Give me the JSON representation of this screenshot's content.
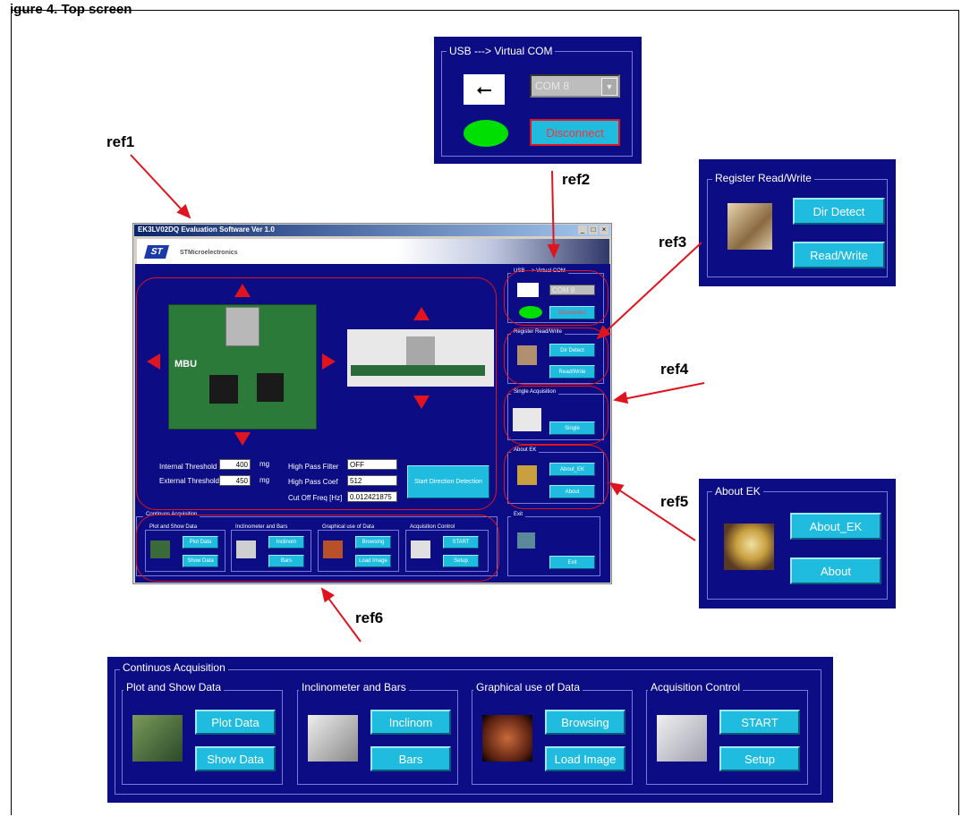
{
  "figure": {
    "title": "igure 4. Top screen"
  },
  "refs": [
    "ref1",
    "ref2",
    "ref3",
    "ref4",
    "ref5",
    "ref6"
  ],
  "colors": {
    "panel": "#0c0c84",
    "button": "#20bce0",
    "annotation": "#e0141e",
    "led": "#00e000"
  },
  "main_window": {
    "title": "EK3LV02DQ Evaluation Software Ver 1.0",
    "brand": "STMicroelectronics",
    "window_buttons": [
      "_",
      "□",
      "×"
    ],
    "usb": {
      "title": "USB ---> Virtual COM",
      "port": "COM 8",
      "button": "Disconnect"
    },
    "register": {
      "title": "Register Read/Write",
      "dir_detect": "Dir Detect",
      "read_write": "Read/Write"
    },
    "single": {
      "title": "Single Acquisition",
      "button": "Single"
    },
    "about": {
      "title": "About EK",
      "about_ek": "About_EK",
      "about": "About"
    },
    "settings": {
      "internal_label": "Internal Threshold",
      "internal_value": "400",
      "internal_unit": "mg",
      "external_label": "External Threshold",
      "external_value": "450",
      "external_unit": "mg",
      "hpf_label": "High Pass Filter",
      "hpf_value": "OFF",
      "hpc_label": "High Pass Coef",
      "hpc_value": "512",
      "cutoff_label": "Cut Off Freq [Hz]",
      "cutoff_value": "0.012421875",
      "start_button": "Start Direction  Detection"
    },
    "exit": {
      "title": "Exit",
      "button": "Exit"
    },
    "continuous": {
      "title": "Continuos Acquisition",
      "groups": [
        {
          "title": "Plot and Show Data",
          "b1": "Plot Data",
          "b2": "Show Data"
        },
        {
          "title": "Inclinometer and Bars",
          "b1": "Inclinom",
          "b2": "Bars"
        },
        {
          "title": "Graphical use of Data",
          "b1": "Browsing",
          "b2": "Load Image"
        },
        {
          "title": "Acquisition Control",
          "b1": "START",
          "b2": "Setup"
        }
      ]
    }
  },
  "usb_zoom": {
    "title": "USB ---> Virtual COM",
    "port": "COM 8",
    "button": "Disconnect"
  },
  "register_zoom": {
    "title": "Register Read/Write",
    "dir_detect": "Dir Detect",
    "read_write": "Read/Write"
  },
  "about_zoom": {
    "title": "About EK",
    "about_ek": "About_EK",
    "about": "About"
  },
  "continuous_zoom": {
    "title": "Continuos Acquisition",
    "groups": [
      {
        "title": "Plot and Show Data",
        "b1": "Plot Data",
        "b2": "Show Data"
      },
      {
        "title": "Inclinometer and Bars",
        "b1": "Inclinom",
        "b2": "Bars"
      },
      {
        "title": "Graphical use of Data",
        "b1": "Browsing",
        "b2": "Load Image"
      },
      {
        "title": "Acquisition Control",
        "b1": "START",
        "b2": "Setup"
      }
    ]
  }
}
